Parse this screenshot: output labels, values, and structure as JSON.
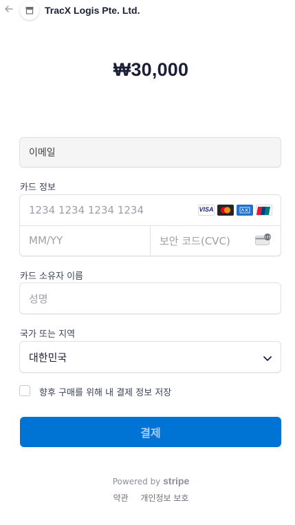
{
  "header": {
    "merchant_name": "TracX Logis Pte. Ltd."
  },
  "amount": "₩30,000",
  "form": {
    "email_placeholder": "이메일",
    "card_label": "카드 정보",
    "card_number_placeholder": "1234 1234 1234 1234",
    "expiry_placeholder": "MM/YY",
    "cvc_placeholder": "보안 코드(CVC)",
    "card_brands": [
      "visa-icon",
      "mastercard-icon",
      "amex-icon",
      "unionpay-icon"
    ],
    "visa_text": "VISA",
    "cvc_badge": "135",
    "name_label": "카드 소유자 이름",
    "name_placeholder": "성명",
    "country_label": "국가 또는 지역",
    "country_value": "대한민국",
    "save_info_label": "향후 구매를 위해 내 결제 정보 저장",
    "save_info_checked": false,
    "pay_button": "결제"
  },
  "footer": {
    "powered_by": "Powered by",
    "stripe": "stripe",
    "terms": "약관",
    "privacy": "개인정보 보호"
  },
  "colors": {
    "primary": "#0074d4",
    "text": "#1a1f36",
    "border": "#e0e0e0"
  }
}
